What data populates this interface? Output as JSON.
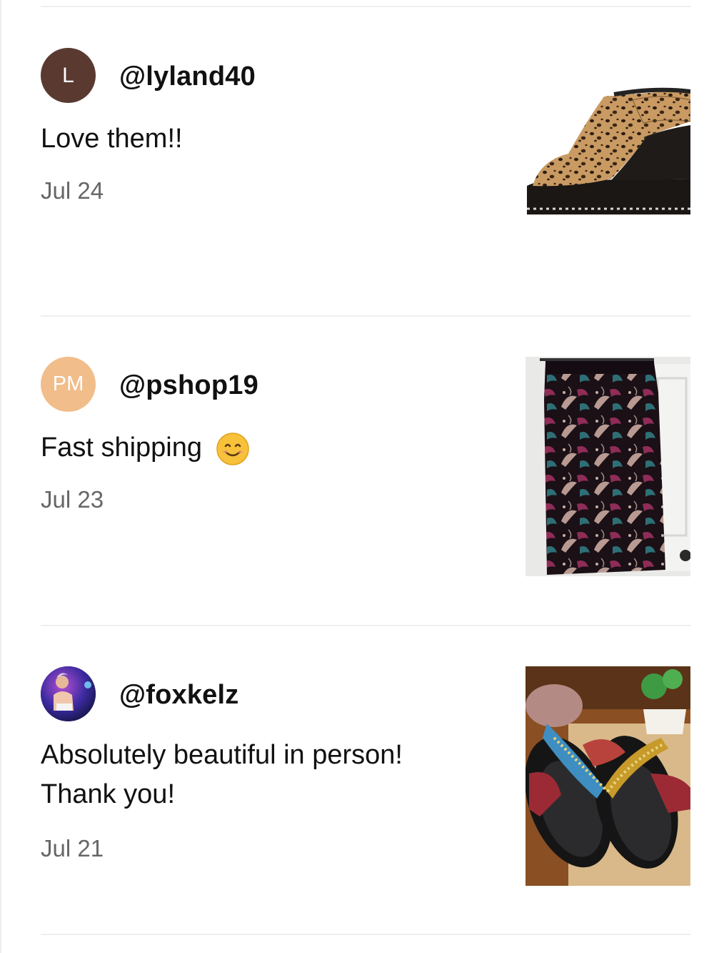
{
  "reviews": [
    {
      "avatar": {
        "type": "letter",
        "text": "L",
        "color": "#5a3a30"
      },
      "username": "@lyland40",
      "comment": "Love them!!",
      "date": "Jul 24",
      "photo": "leopard-print-wedge-sandal"
    },
    {
      "avatar": {
        "type": "initials",
        "text": "PM",
        "color": "#f1bd8b"
      },
      "username": "@pshop19",
      "comment": "Fast shipping",
      "comment_emoji": "smiling-face-emoji",
      "date": "Jul 23",
      "photo": "floral-print-skirt"
    },
    {
      "avatar": {
        "type": "photo"
      },
      "username": "@foxkelz",
      "comment_lines": [
        "Absolutely beautiful in person!",
        "Thank you!"
      ],
      "date": "Jul 21",
      "photo": "embellished-slide-sandals"
    }
  ]
}
